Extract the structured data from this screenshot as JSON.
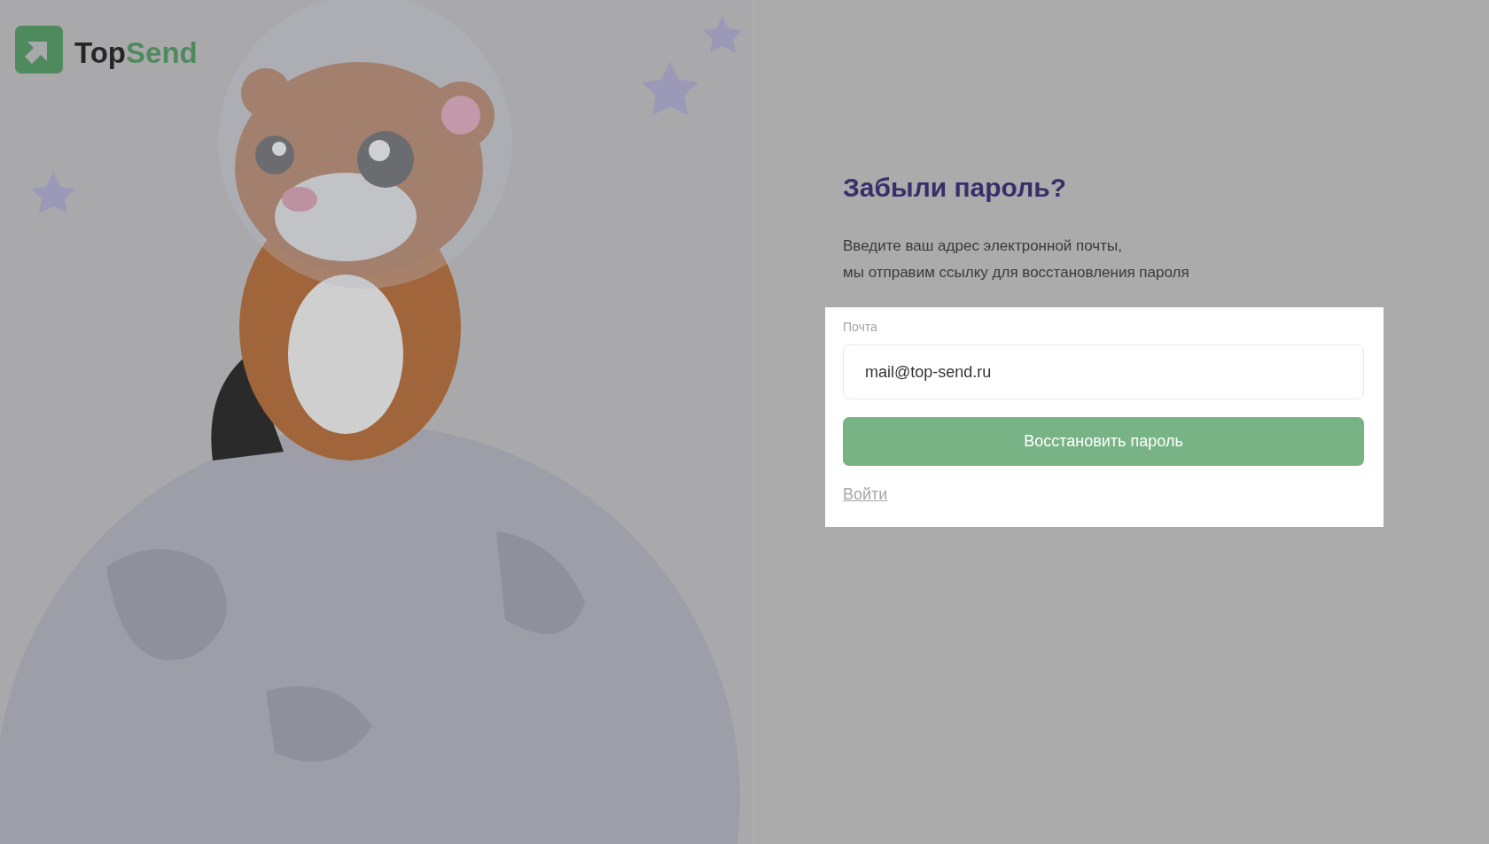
{
  "logo": {
    "part_1": "Top",
    "part_2": "Send"
  },
  "heading": "Забыли пароль?",
  "description": [
    "Введите ваш адрес электронной почты,",
    "мы отправим ссылку для восстановления пароля"
  ],
  "form": {
    "email_label": "Почта",
    "email_value": "mail@top-send.ru",
    "submit_button": "Восстановить пароль",
    "login_link": "Войти"
  }
}
